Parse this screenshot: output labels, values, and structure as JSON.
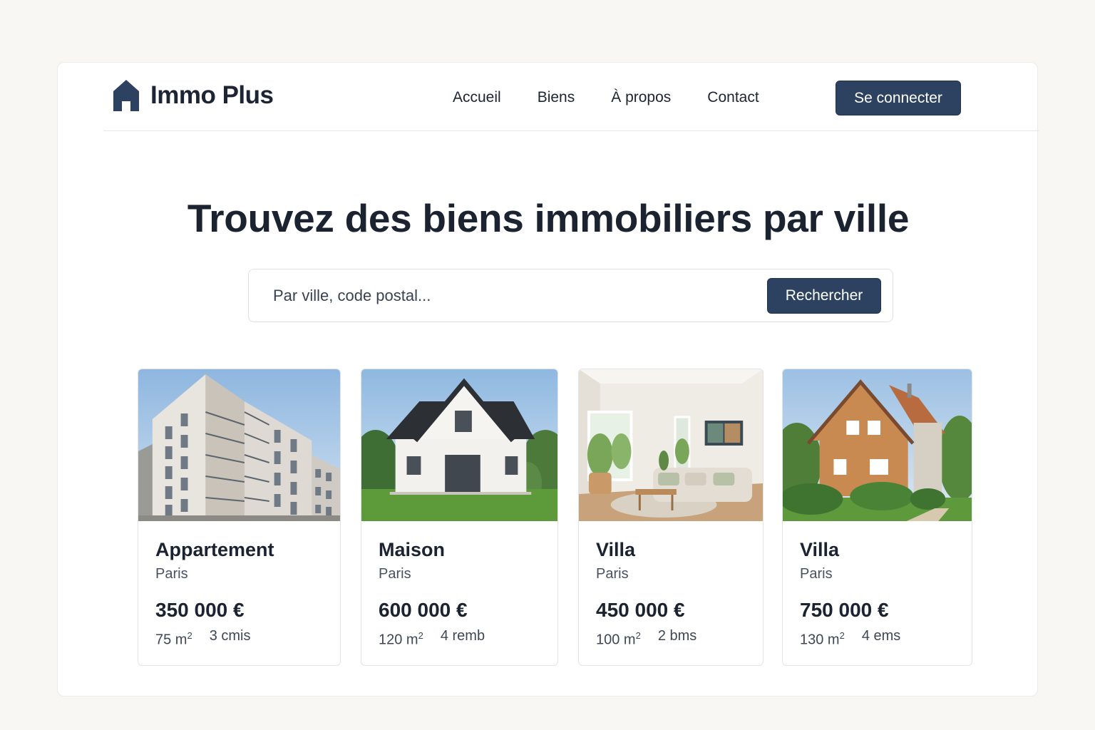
{
  "app": {
    "name": "Immo Plus",
    "logo_icon": "house-icon",
    "brand_color": "#2d4260"
  },
  "nav": {
    "items": [
      "Accueil",
      "Biens",
      "À propos",
      "Contact"
    ]
  },
  "header": {
    "login_label": "Se connecter"
  },
  "hero": {
    "title": "Trouvez des biens immobiliers par ville"
  },
  "search": {
    "placeholder": "Par ville, code postal...",
    "button_label": "Rechercher"
  },
  "listings": [
    {
      "type": "Appartement",
      "city": "Paris",
      "price": "350 000 €",
      "area": "75 m",
      "area_unit_exp": "2",
      "rooms": "3 cmis",
      "image": "apartment-building-photo"
    },
    {
      "type": "Maison",
      "city": "Paris",
      "price": "600 000 €",
      "area": "120 m",
      "area_unit_exp": "2",
      "rooms": "4 remb",
      "image": "white-house-photo"
    },
    {
      "type": "Villa",
      "city": "Paris",
      "price": "450 000 €",
      "area": "100 m",
      "area_unit_exp": "2",
      "rooms": "2 bms",
      "image": "living-room-photo"
    },
    {
      "type": "Villa",
      "city": "Paris",
      "price": "750 000 €",
      "area": "130 m",
      "area_unit_exp": "2",
      "rooms": "4 ems",
      "image": "brick-house-photo"
    }
  ]
}
